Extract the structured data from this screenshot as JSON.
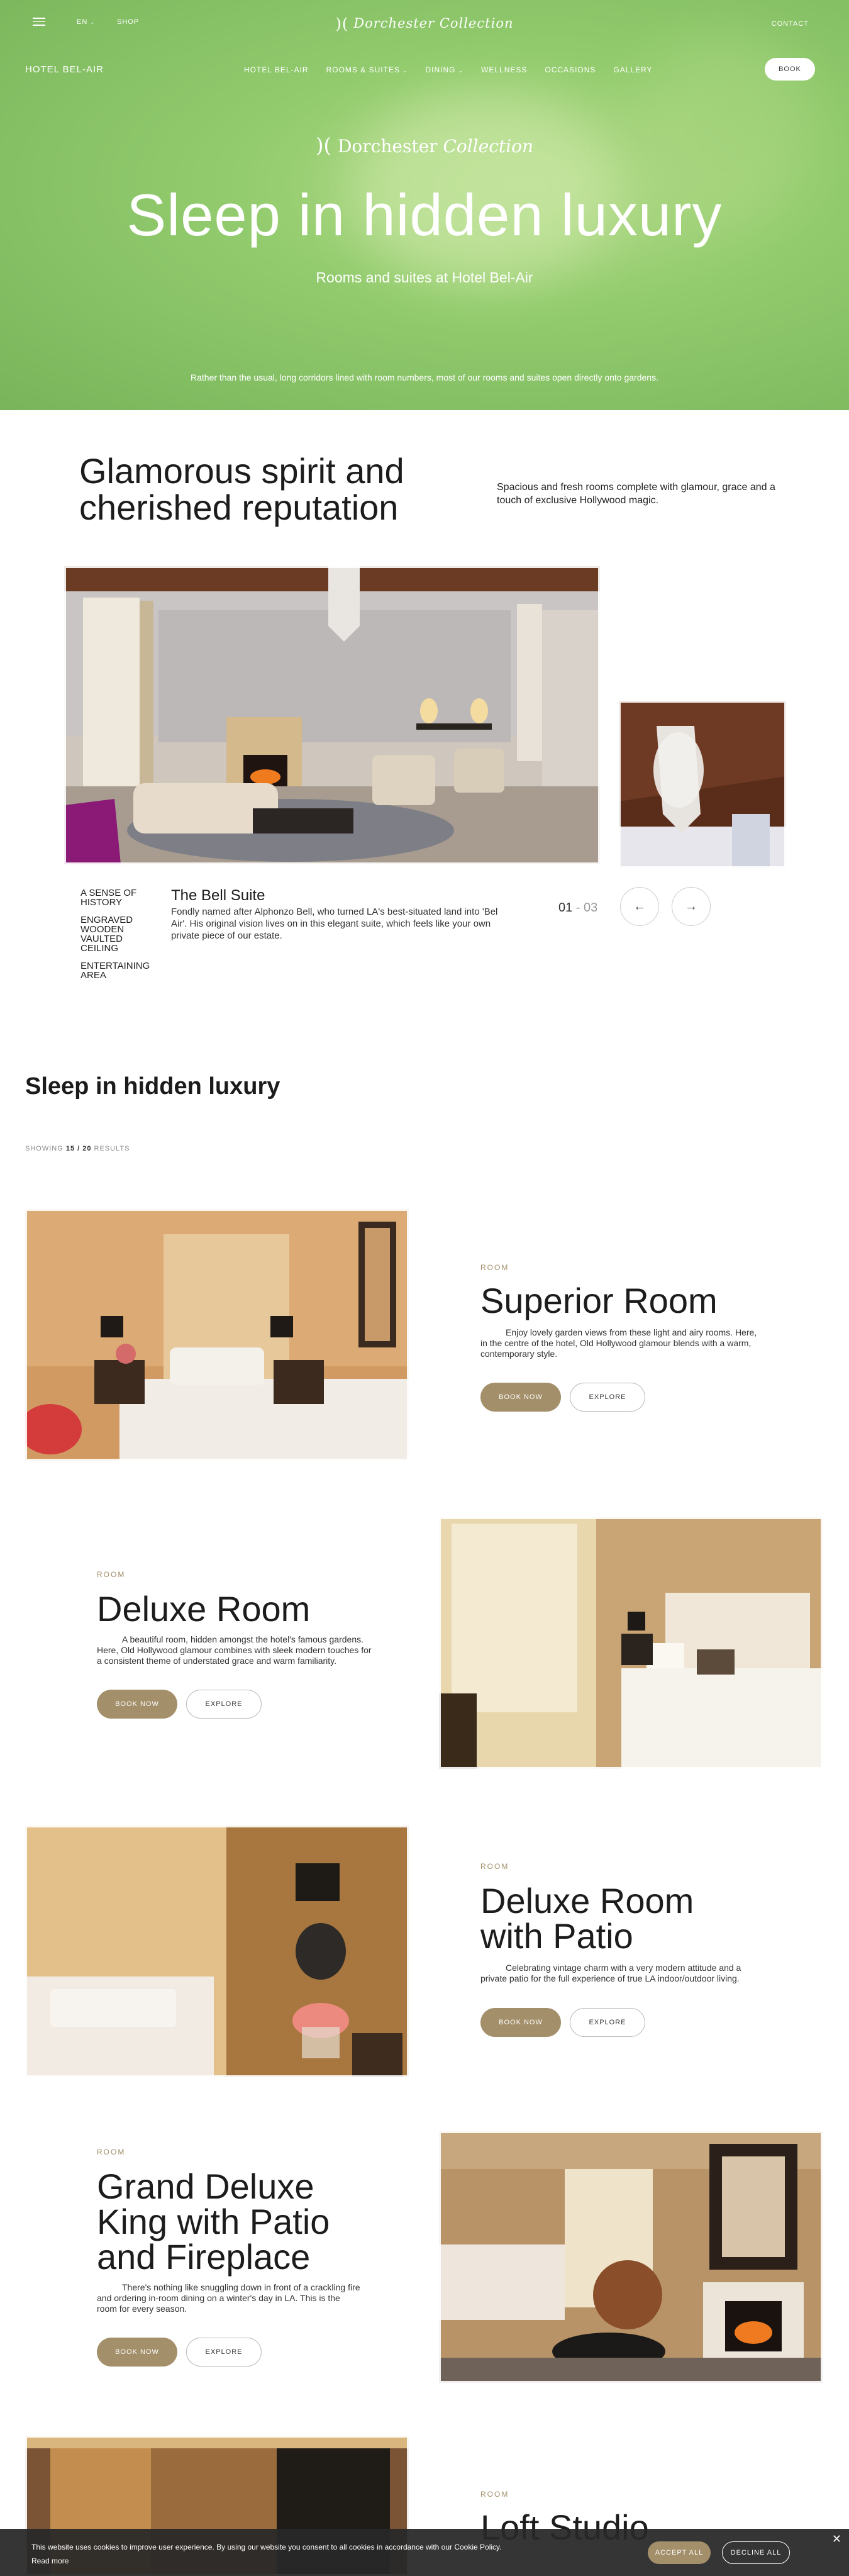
{
  "header": {
    "lang": "EN",
    "shop": "SHOP",
    "brand": "Dorchester",
    "brand_italic": "Collection",
    "contact": "CONTACT",
    "hotel_name": "HOTEL BEL-AIR",
    "nav": [
      "HOTEL BEL-AIR",
      "ROOMS & SUITES",
      "DINING",
      "WELLNESS",
      "OCCASIONS",
      "GALLERY"
    ],
    "book": "BOOK"
  },
  "hero": {
    "brand": "Dorchester",
    "brand_italic": "Collection",
    "title": "Sleep in hidden luxury",
    "subtitle": "Rooms and suites at Hotel Bel-Air",
    "note": "Rather than the usual, long corridors lined with room numbers, most of our rooms and suites open directly onto gardens."
  },
  "intro": {
    "title_line1": "Glamorous spirit and",
    "title_line2": "cherished reputation",
    "text": "Spacious and fresh rooms complete with glamour, grace and a touch of exclusive Hollywood magic."
  },
  "slider": {
    "tabs": [
      "A SENSE OF HISTORY",
      "ENGRAVED WOODEN VAULTED CEILING",
      "ENTERTAINING AREA"
    ],
    "title": "The Bell Suite",
    "description": "Fondly named after Alphonzo Bell, who turned LA's best-situated land into 'Bel Air'. His original vision lives on in this elegant suite, which feels like your own private piece of our estate.",
    "current": "01",
    "separator": " - ",
    "total": "03"
  },
  "list": {
    "title": "Sleep in hidden luxury",
    "results_prefix": "SHOWING",
    "results_count": "15 / 20",
    "results_suffix": "RESULTS"
  },
  "rooms": [
    {
      "kicker": "ROOM",
      "title": "Superior Room",
      "desc": "Enjoy lovely garden views from these light and airy rooms. Here, in the centre of the hotel, Old Hollywood glamour blends with a warm, contemporary style.",
      "book": "BOOK NOW",
      "explore": "EXPLORE"
    },
    {
      "kicker": "ROOM",
      "title": "Deluxe Room",
      "desc": "A beautiful room, hidden amongst the hotel's famous gardens. Here, Old Hollywood glamour combines with sleek modern touches for a consistent theme of understated grace and warm familiarity.",
      "book": "BOOK NOW",
      "explore": "EXPLORE"
    },
    {
      "kicker": "ROOM",
      "title": "Deluxe Room with Patio",
      "desc": "Celebrating vintage charm with a very modern attitude and a private patio for the full experience of true LA indoor/outdoor living.",
      "book": "BOOK NOW",
      "explore": "EXPLORE"
    },
    {
      "kicker": "ROOM",
      "title": "Grand Deluxe King with Patio and Fireplace",
      "desc": "There's nothing like snuggling down in front of a crackling fire and ordering in-room dining on a winter's day in LA. This is the room for every season.",
      "book": "BOOK NOW",
      "explore": "EXPLORE"
    },
    {
      "kicker": "ROOM",
      "title": "Loft Studio"
    }
  ],
  "cookie": {
    "text": "This website uses cookies to improve user experience. By using our website you consent to all cookies in accordance with our Cookie Policy.",
    "more": "Read more",
    "accept": "ACCEPT ALL",
    "decline": "DECLINE ALL",
    "close": "✕"
  },
  "colors": {
    "accent": "#a38f6a",
    "hero_green": "#93cc6e"
  }
}
